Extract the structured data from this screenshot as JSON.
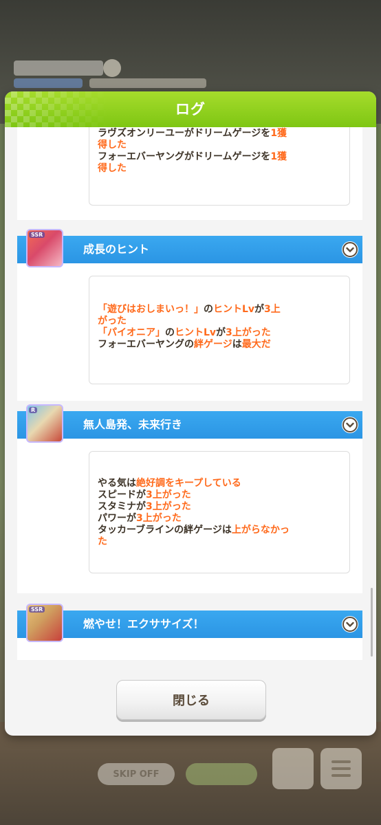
{
  "modal": {
    "title": "ログ",
    "close_label": "閉じる"
  },
  "background": {
    "skip_label": "SKIP OFF"
  },
  "entries": [
    {
      "title": "",
      "lines": [
        [
          {
            "t": "ラヴズオンリーユーがドリームゲージを",
            "o": false
          },
          {
            "t": "1獲",
            "o": true
          }
        ],
        [
          {
            "t": "得した",
            "o": true
          }
        ],
        [
          {
            "t": "フォーエバーヤングがドリームゲージを",
            "o": false
          },
          {
            "t": "1獲",
            "o": true
          }
        ],
        [
          {
            "t": "得した",
            "o": true
          }
        ]
      ]
    },
    {
      "title": "成長のヒント",
      "rarity": "SSR",
      "lines": [
        [
          {
            "t": "「遊びはおしまいっ！」",
            "o": true
          },
          {
            "t": "の",
            "o": false
          },
          {
            "t": "ヒントLv",
            "o": true
          },
          {
            "t": "が",
            "o": false
          },
          {
            "t": "3上",
            "o": true
          }
        ],
        [
          {
            "t": "がった",
            "o": true
          }
        ],
        [
          {
            "t": "「パイオニア」",
            "o": true
          },
          {
            "t": "の",
            "o": false
          },
          {
            "t": "ヒントLv",
            "o": true
          },
          {
            "t": "が",
            "o": false
          },
          {
            "t": "3上がった",
            "o": true
          }
        ],
        [
          {
            "t": "フォーエバーヤングの",
            "o": false
          },
          {
            "t": "絆ゲージ",
            "o": true
          },
          {
            "t": "は",
            "o": false
          },
          {
            "t": "最大だ",
            "o": true
          }
        ]
      ]
    },
    {
      "title": "無人島発、未来行き",
      "rarity": "R",
      "lines": [
        [
          {
            "t": "やる気は",
            "o": false
          },
          {
            "t": "絶好調をキープしている",
            "o": true
          }
        ],
        [
          {
            "t": "スピードが",
            "o": false
          },
          {
            "t": "3上がった",
            "o": true
          }
        ],
        [
          {
            "t": "スタミナが",
            "o": false
          },
          {
            "t": "3上がった",
            "o": true
          }
        ],
        [
          {
            "t": "パワーが",
            "o": false
          },
          {
            "t": "3上がった",
            "o": true
          }
        ],
        [
          {
            "t": "タッカーブラインの絆ゲージは",
            "o": false
          },
          {
            "t": "上がらなかっ",
            "o": true
          }
        ],
        [
          {
            "t": "た",
            "o": true
          }
        ]
      ]
    },
    {
      "title": "燃やせ！エクササイズ！",
      "rarity": "SSR",
      "lines": []
    }
  ],
  "colors": {
    "header_green": "#7ec613",
    "entry_blue": "#2b95e4",
    "highlight_orange": "#ff6a1c",
    "text_brown": "#3d3327"
  },
  "icons": [
    "chevron-down-icon",
    "menu-icon"
  ]
}
